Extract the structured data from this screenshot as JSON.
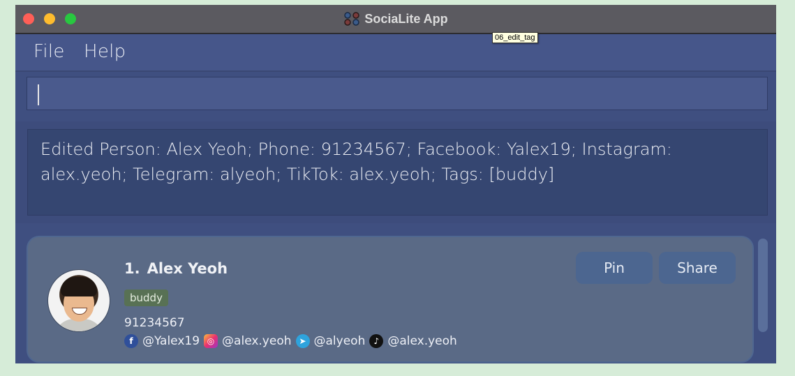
{
  "window": {
    "title": "SociaLite App",
    "app_icon": "socialite-logo-icon"
  },
  "tooltip": "06_edit_tag",
  "menu": [
    "File",
    "Help"
  ],
  "command_box": {
    "value": ""
  },
  "result": {
    "text": "Edited Person: Alex Yeoh; Phone: 91234567; Facebook: Yalex19; Instagram: alex.yeoh; Telegram: alyeoh; TikTok: alex.yeoh; Tags: [buddy]"
  },
  "person_card": {
    "index": "1.",
    "name": "Alex Yeoh",
    "tag": "buddy",
    "phone": "91234567",
    "socials": [
      {
        "icon": "facebook-icon",
        "glyph": "f",
        "handle": "@Yalex19"
      },
      {
        "icon": "instagram-icon",
        "glyph": "◎",
        "handle": "@alex.yeoh"
      },
      {
        "icon": "telegram-icon",
        "glyph": "➤",
        "handle": "@alyeoh"
      },
      {
        "icon": "tiktok-icon",
        "glyph": "♪",
        "handle": "@alex.yeoh"
      }
    ],
    "buttons": {
      "pin": "Pin",
      "share": "Share"
    }
  },
  "colors": {
    "window_bg": "#3f4f80",
    "titlebar": "#5b5a60",
    "tag_bg": "#587154",
    "button_bg": "#4c6690"
  }
}
